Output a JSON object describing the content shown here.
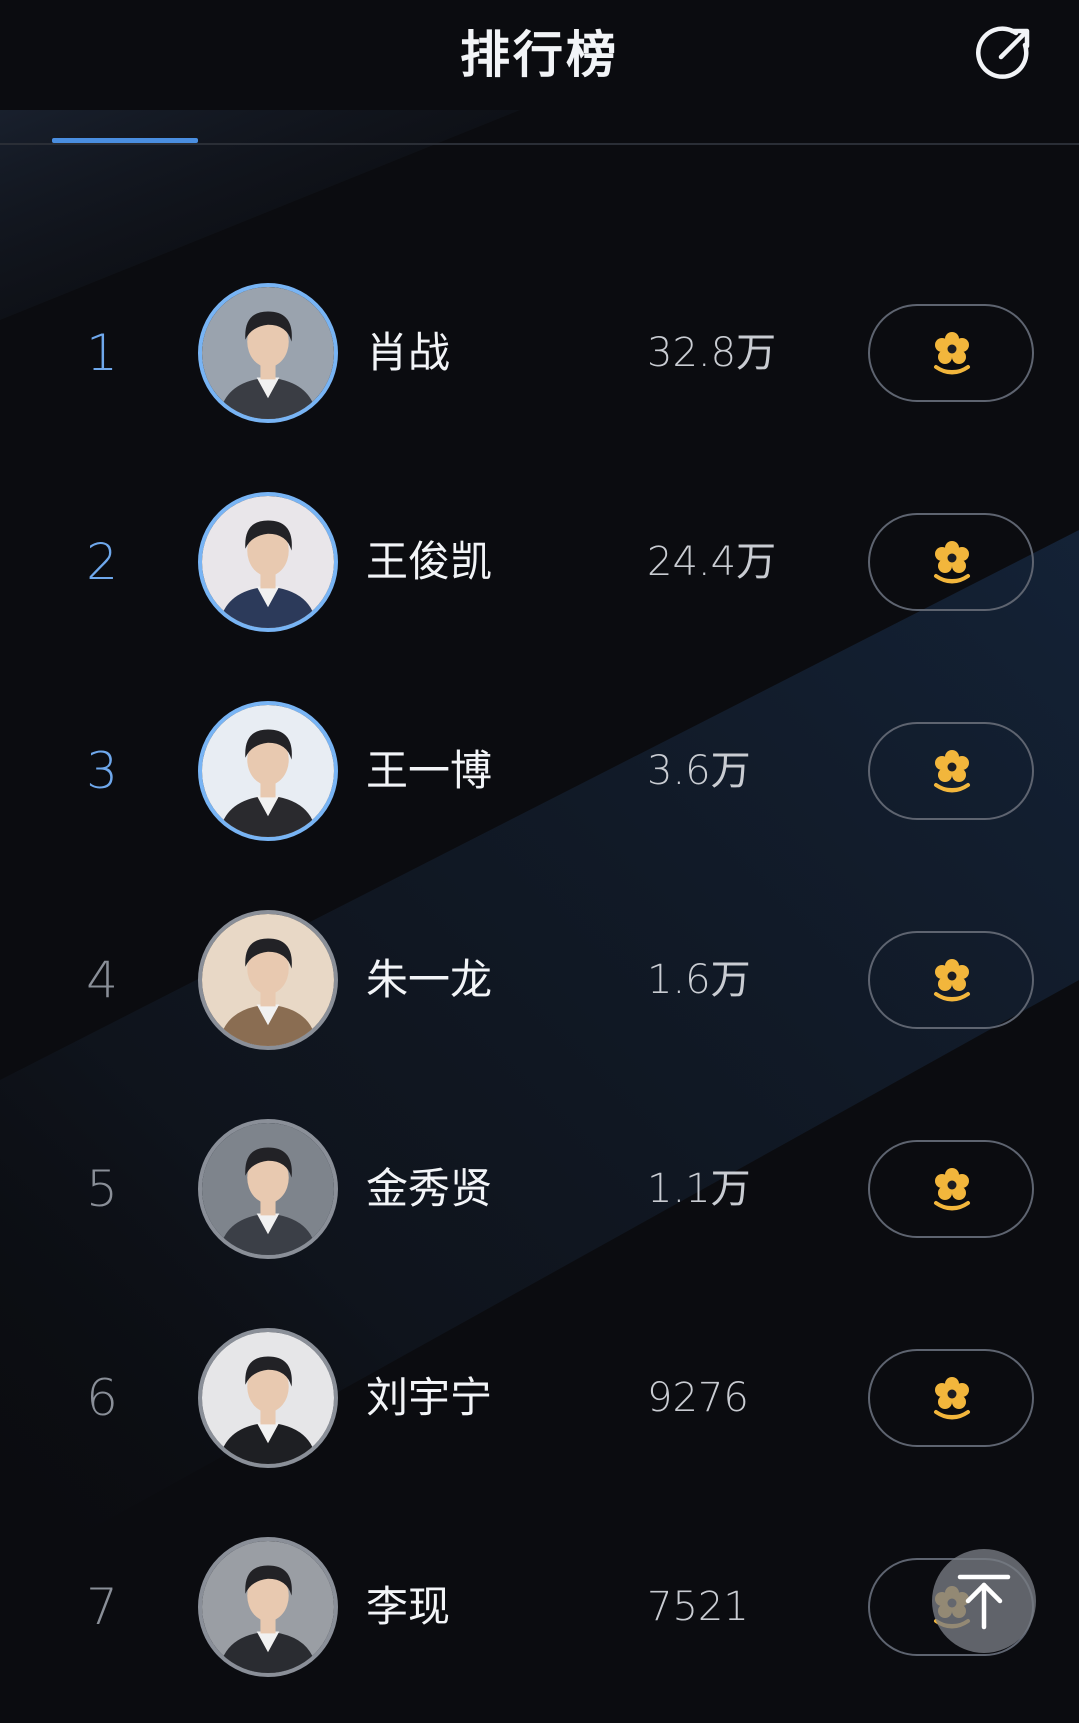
{
  "header": {
    "title": "排行榜",
    "share_icon": "share-arrow-icon",
    "active_tab_indicator_color": "#4a8ee0"
  },
  "ranking": [
    {
      "rank": "1",
      "name": "肖战",
      "score": "32.8万",
      "highlight": true
    },
    {
      "rank": "2",
      "name": "王俊凯",
      "score": "24.4万",
      "highlight": true
    },
    {
      "rank": "3",
      "name": "王一博",
      "score": "3.6万",
      "highlight": true
    },
    {
      "rank": "4",
      "name": "朱一龙",
      "score": "1.6万",
      "highlight": false
    },
    {
      "rank": "5",
      "name": "金秀贤",
      "score": "1.1万",
      "highlight": false
    },
    {
      "rank": "6",
      "name": "刘宇宁",
      "score": "9276",
      "highlight": false
    },
    {
      "rank": "7",
      "name": "李现",
      "score": "7521",
      "highlight": false
    }
  ],
  "action_icon": "flower-icon",
  "scroll_top_icon": "back-to-top-icon",
  "colors": {
    "background": "#0b0c10",
    "top_rank_accent": "#6fa8ec",
    "flower": "#f2b63c"
  }
}
